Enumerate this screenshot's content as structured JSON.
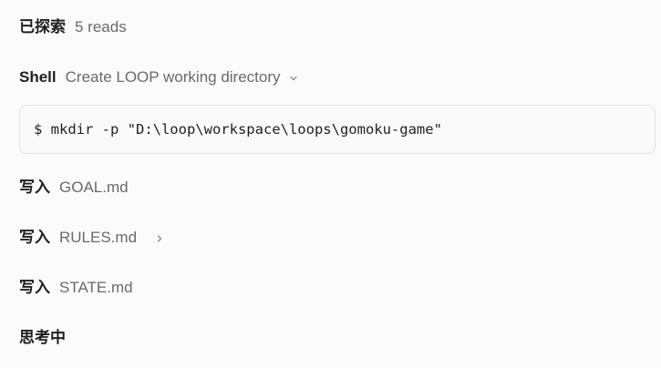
{
  "explored": {
    "label": "已探索",
    "detail": "5 reads"
  },
  "shell": {
    "label": "Shell",
    "description": "Create LOOP working directory",
    "expand_icon": "chevron-down-icon",
    "command": "$ mkdir -p \"D:\\loop\\workspace\\loops\\gomoku-game\""
  },
  "writes": [
    {
      "label": "写入",
      "file": "GOAL.md"
    },
    {
      "label": "写入",
      "file": "RULES.md",
      "expand_icon": "chevron-right-icon"
    },
    {
      "label": "写入",
      "file": "STATE.md"
    }
  ],
  "thinking": {
    "label": "思考中"
  }
}
